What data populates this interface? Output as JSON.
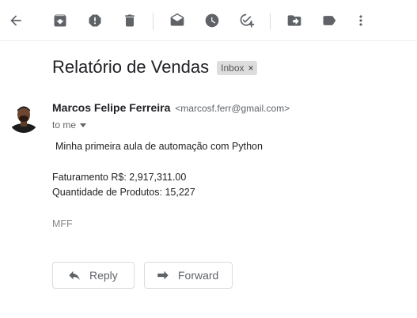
{
  "toolbar": {
    "icons": [
      "back-arrow-icon",
      "archive-icon",
      "report-spam-icon",
      "delete-icon",
      "mark-unread-icon",
      "snooze-icon",
      "add-to-tasks-icon",
      "move-to-icon",
      "label-icon",
      "more-icon"
    ]
  },
  "email": {
    "subject": "Relatório de Vendas",
    "label": "Inbox",
    "label_close": "×",
    "sender_name": "Marcos Felipe Ferreira",
    "sender_email": "<marcosf.ferr@gmail.com>",
    "to": "to me",
    "body": {
      "line1": "Minha primeira aula de automação com Python",
      "line2": "Faturamento R$: 2,917,311.00",
      "line3": "Quantidade de Produtos: 15,227",
      "signature": "MFF"
    }
  },
  "actions": {
    "reply": "Reply",
    "forward": "Forward"
  },
  "colors": {
    "icon": "#5f6368",
    "text": "#202124",
    "chip_bg": "#dddddd",
    "border": "#dadce0"
  }
}
